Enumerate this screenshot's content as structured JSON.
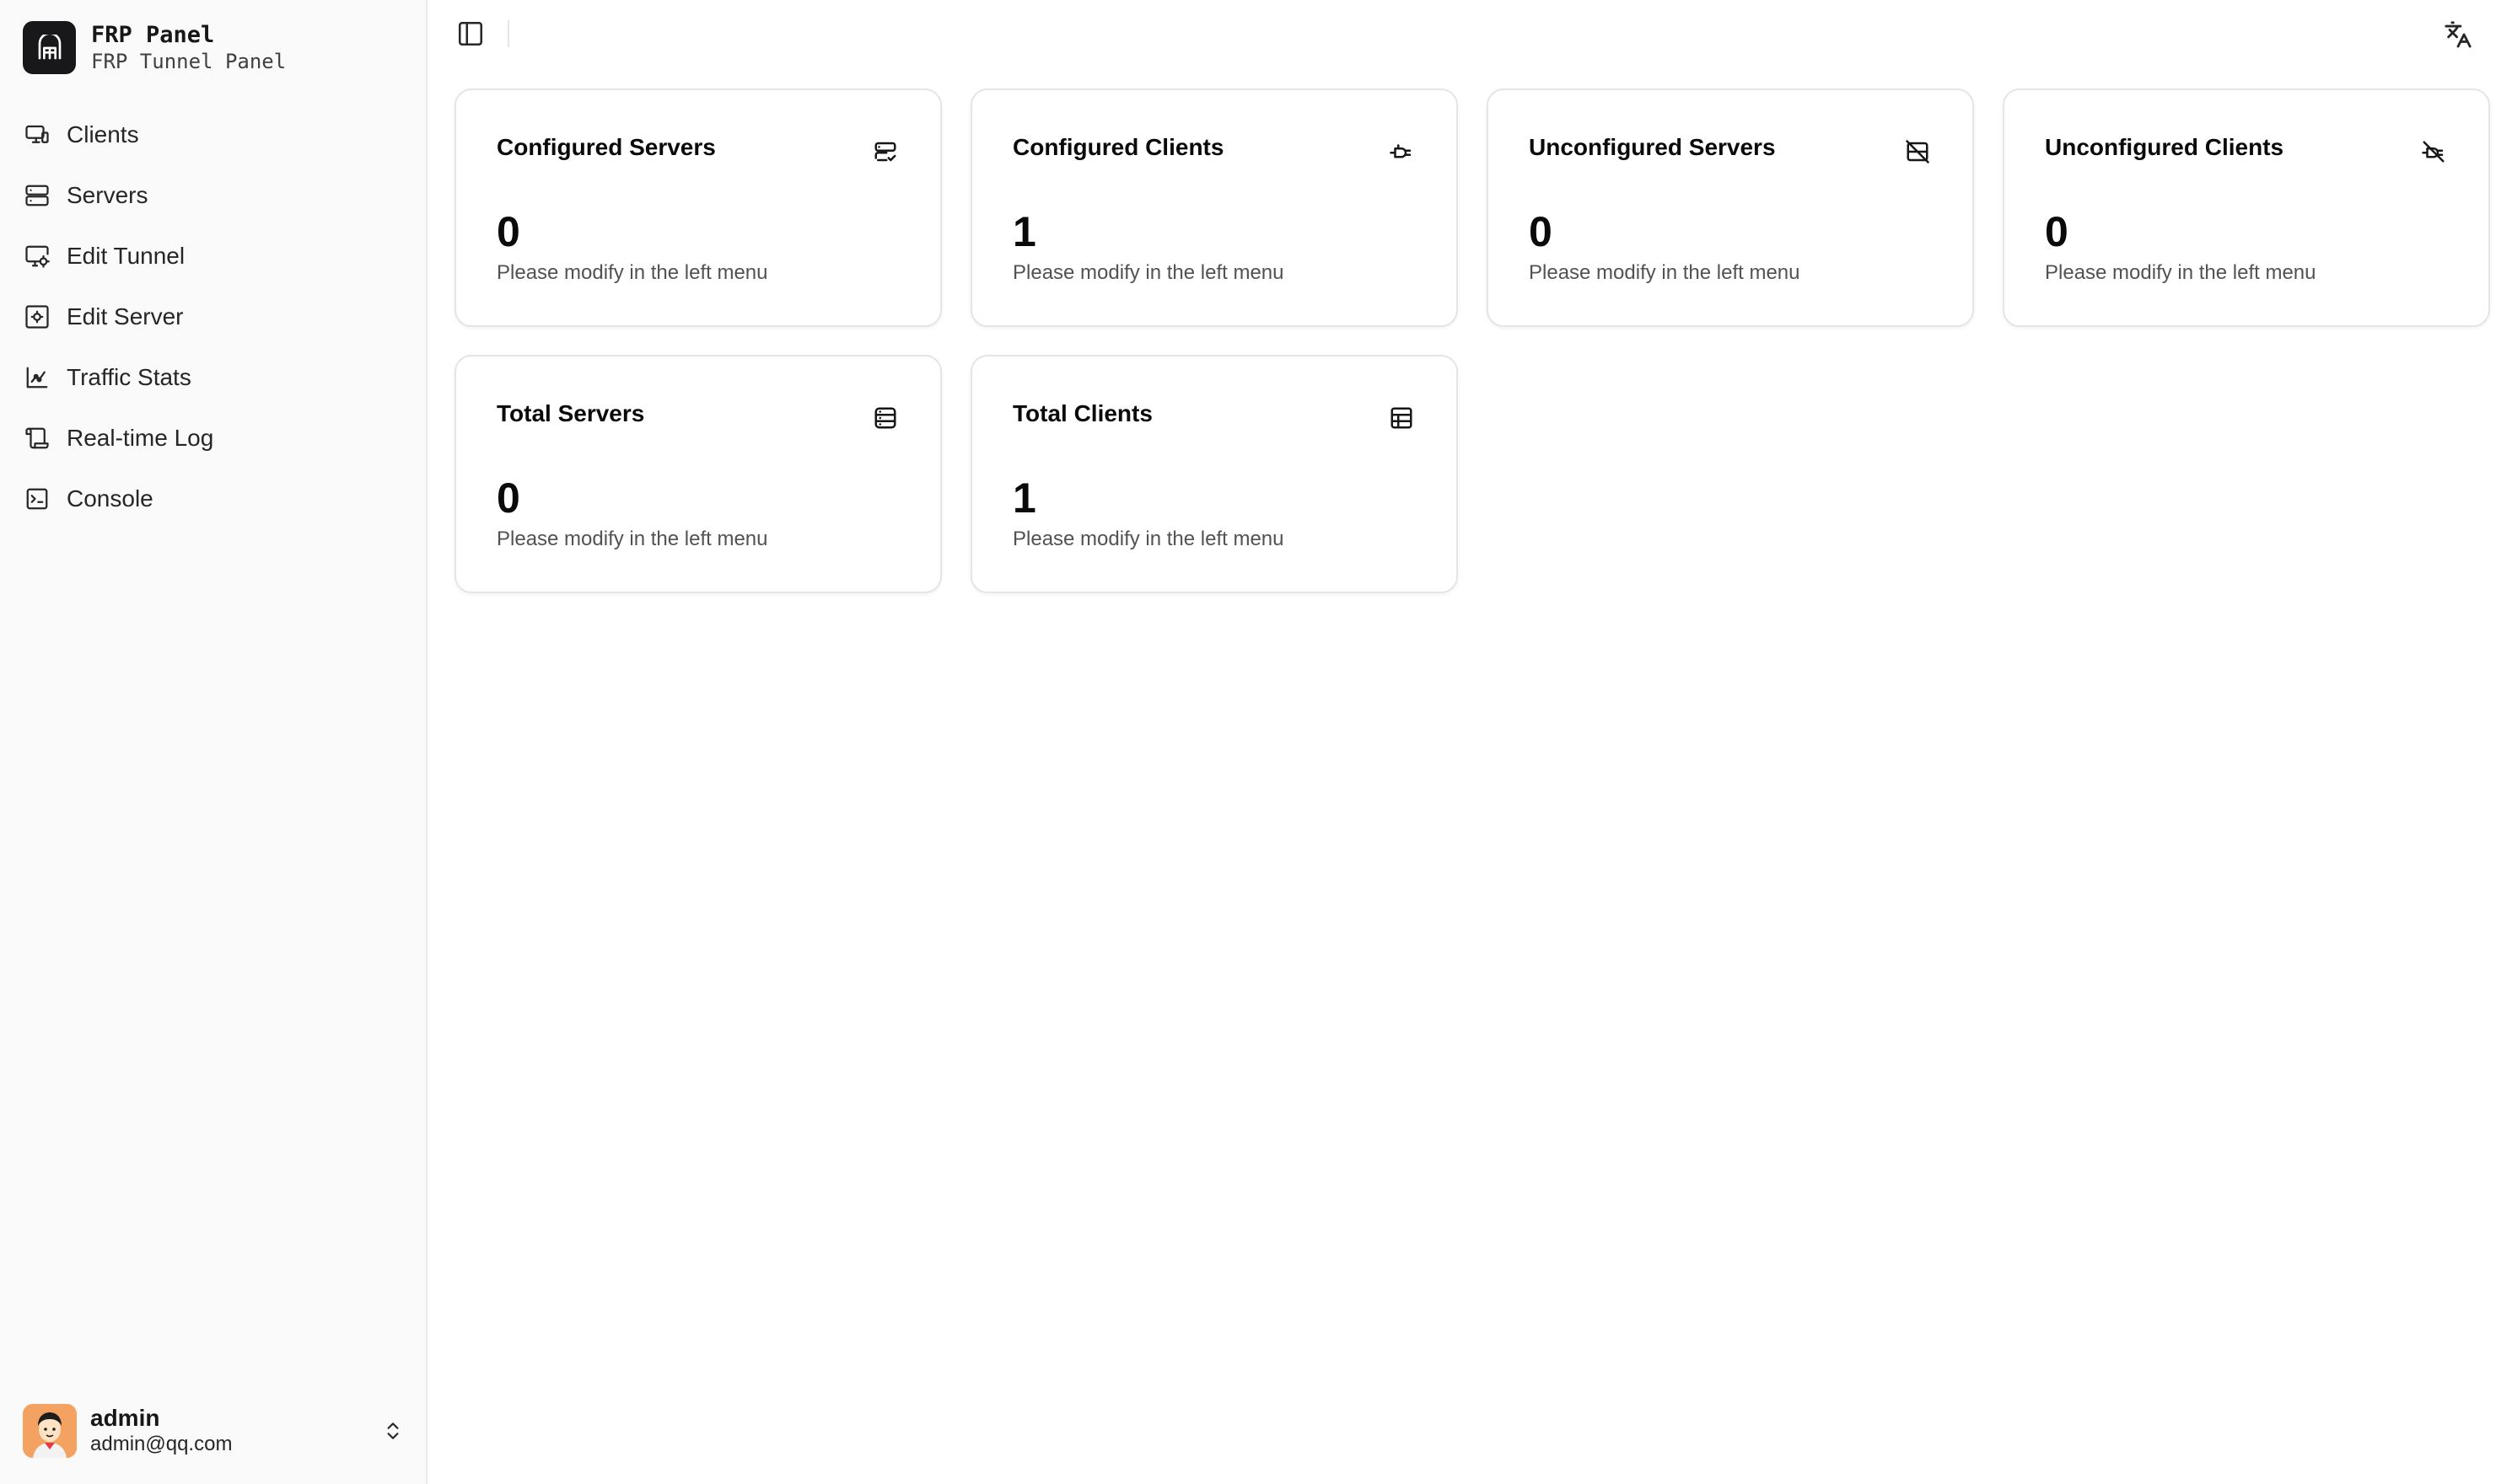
{
  "brand": {
    "title": "FRP Panel",
    "subtitle": "FRP Tunnel Panel"
  },
  "sidebar": {
    "items": [
      {
        "label": "Clients",
        "icon": "monitor-icon"
      },
      {
        "label": "Servers",
        "icon": "server-icon"
      },
      {
        "label": "Edit Tunnel",
        "icon": "monitor-cog-icon"
      },
      {
        "label": "Edit Server",
        "icon": "server-cog-icon"
      },
      {
        "label": "Traffic Stats",
        "icon": "chart-icon"
      },
      {
        "label": "Real-time Log",
        "icon": "scroll-icon"
      },
      {
        "label": "Console",
        "icon": "terminal-icon"
      }
    ]
  },
  "user": {
    "name": "admin",
    "email": "admin@qq.com"
  },
  "cards": [
    {
      "title": "Configured Servers",
      "value": "0",
      "note": "Please modify in the left menu",
      "icon": "server-check-icon"
    },
    {
      "title": "Configured Clients",
      "value": "1",
      "note": "Please modify in the left menu",
      "icon": "plug-icon"
    },
    {
      "title": "Unconfigured Servers",
      "value": "0",
      "note": "Please modify in the left menu",
      "icon": "server-off-icon"
    },
    {
      "title": "Unconfigured Clients",
      "value": "0",
      "note": "Please modify in the left menu",
      "icon": "plug-off-icon"
    },
    {
      "title": "Total Servers",
      "value": "0",
      "note": "Please modify in the left menu",
      "icon": "servers-icon"
    },
    {
      "title": "Total Clients",
      "value": "1",
      "note": "Please modify in the left menu",
      "icon": "clients-icon"
    }
  ],
  "colors": {
    "sidebar_bg": "#fafafa",
    "logo_bg": "#18181b",
    "avatar_bg": "#f4a261",
    "muted_text": "#525252"
  }
}
